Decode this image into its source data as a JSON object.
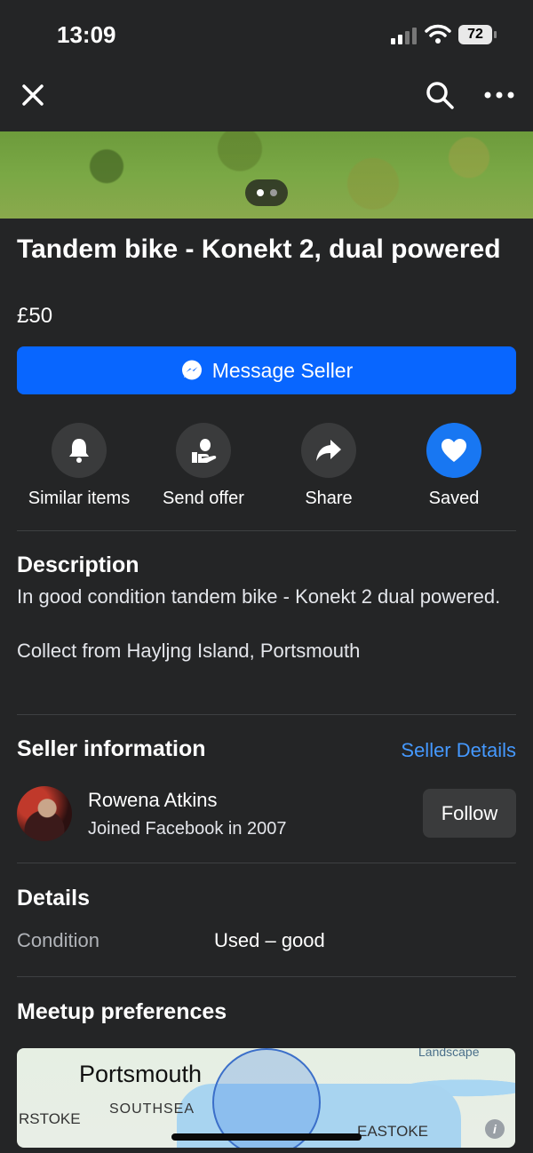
{
  "status_bar": {
    "time": "13:09",
    "battery": "72"
  },
  "listing": {
    "title": "Tandem bike - Konekt 2, dual powered",
    "price": "£50",
    "message_button": "Message Seller"
  },
  "actions": [
    {
      "label": "Similar items",
      "icon": "bell-icon"
    },
    {
      "label": "Send offer",
      "icon": "offer-icon"
    },
    {
      "label": "Share",
      "icon": "share-icon"
    },
    {
      "label": "Saved",
      "icon": "heart-icon"
    }
  ],
  "description": {
    "heading": "Description",
    "line1": "In good condition tandem bike - Konekt 2 dual powered.",
    "line2": "Collect from Hayljng Island, Portsmouth"
  },
  "seller": {
    "heading": "Seller information",
    "details_link": "Seller Details",
    "name": "Rowena Atkins",
    "joined": "Joined Facebook in 2007",
    "follow": "Follow"
  },
  "details": {
    "heading": "Details",
    "condition_label": "Condition",
    "condition_value": "Used – good"
  },
  "meetup": {
    "heading": "Meetup preferences",
    "map_labels": {
      "landscape": "Landscape",
      "city": "Portsmouth",
      "southsea": "SOUTHSEA",
      "rstoke": "RSTOKE",
      "eastoke": "EASTOKE"
    }
  },
  "colors": {
    "background": "#242526",
    "accent": "#0866ff",
    "link": "#4599ff",
    "saved": "#1877f2"
  }
}
